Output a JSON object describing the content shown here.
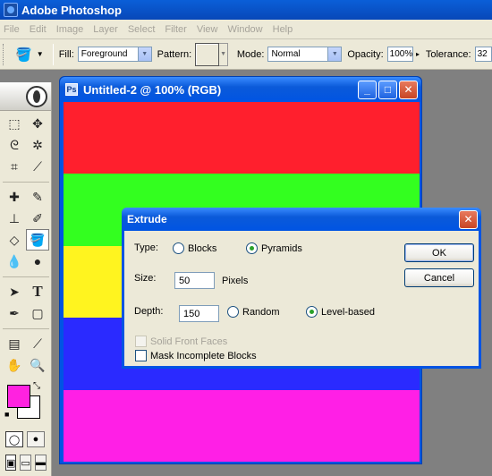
{
  "app": {
    "title": "Adobe Photoshop"
  },
  "menu": [
    "File",
    "Edit",
    "Image",
    "Layer",
    "Select",
    "Filter",
    "View",
    "Window",
    "Help"
  ],
  "options": {
    "fill_label": "Fill:",
    "fill_value": "Foreground",
    "pattern_label": "Pattern:",
    "mode_label": "Mode:",
    "mode_value": "Normal",
    "opacity_label": "Opacity:",
    "opacity_value": "100%",
    "tolerance_label": "Tolerance:",
    "tolerance_value": "32"
  },
  "colors": {
    "foreground": "#ff22e0",
    "background": "#ffffff"
  },
  "document": {
    "title": "Untitled-2 @ 100% (RGB)",
    "stripes": [
      "#ff1f2d",
      "#33ff1f",
      "#fff41f",
      "#2a2aff",
      "#ff1fe6"
    ]
  },
  "dialog": {
    "title": "Extrude",
    "type_label": "Type:",
    "type_blocks": "Blocks",
    "type_pyramids": "Pyramids",
    "size_label": "Size:",
    "size_value": "50",
    "size_unit": "Pixels",
    "depth_label": "Depth:",
    "depth_value": "150",
    "depth_random": "Random",
    "depth_level": "Level-based",
    "solid_front": "Solid Front Faces",
    "mask_incomplete": "Mask Incomplete Blocks",
    "ok": "OK",
    "cancel": "Cancel"
  }
}
